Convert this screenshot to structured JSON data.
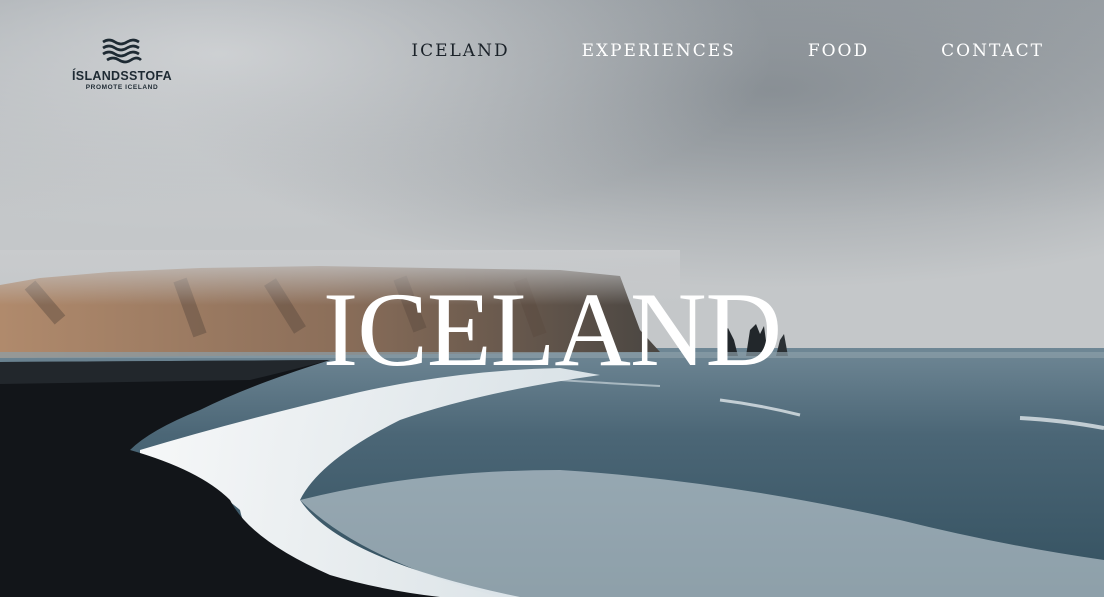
{
  "logo": {
    "brand": "ÍSLANDSSTOFA",
    "tagline": "PROMOTE ICELAND",
    "icon": "waves-icon"
  },
  "nav": {
    "items": [
      {
        "label": "ICELAND",
        "active": true
      },
      {
        "label": "EXPERIENCES",
        "active": false
      },
      {
        "label": "FOOD",
        "active": false
      },
      {
        "label": "CONTACT",
        "active": false
      }
    ]
  },
  "hero": {
    "title": "ICELAND"
  },
  "colors": {
    "sky": "#a9aeb3",
    "sea": "#3f5a6a",
    "beach": "#14171c",
    "cliff": "#9a7a62",
    "nav_active": "#1b2229",
    "nav_default": "#ffffff"
  }
}
